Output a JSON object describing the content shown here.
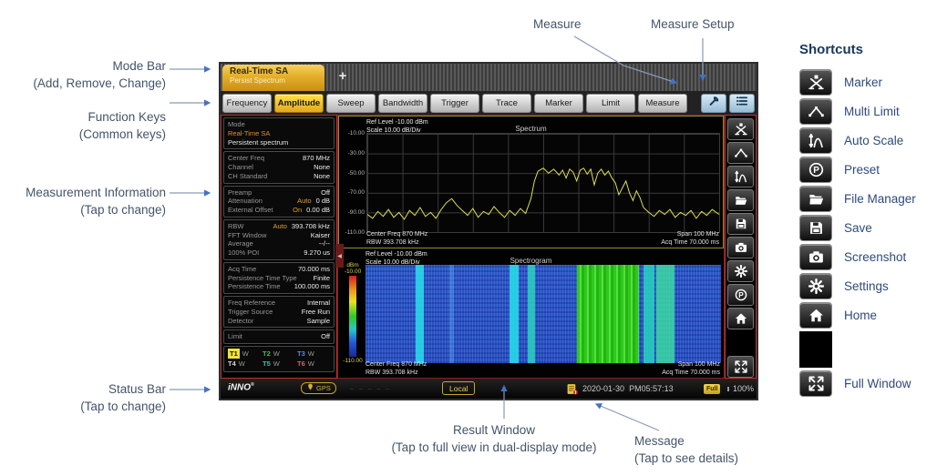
{
  "annotations": {
    "measure": "Measure",
    "measure_setup": "Measure Setup",
    "mode_bar": {
      "line1": "Mode Bar",
      "line2": "(Add, Remove, Change)"
    },
    "function_keys": {
      "line1": "Function Keys",
      "line2": "(Common keys)"
    },
    "measurement_info": {
      "line1": "Measurement Information",
      "line2": "(Tap to change)"
    },
    "status_bar": {
      "line1": "Status Bar",
      "line2": "(Tap to change)"
    },
    "result_window": {
      "line1": "Result Window",
      "line2": "(Tap to full view in dual-display mode)"
    },
    "message": {
      "line1": "Message",
      "line2": "(Tap to see details)"
    }
  },
  "shortcuts": {
    "title": "Shortcuts",
    "items": [
      {
        "icon": "marker",
        "label": "Marker"
      },
      {
        "icon": "multi-limit",
        "label": "Multi Limit"
      },
      {
        "icon": "auto-scale",
        "label": "Auto Scale"
      },
      {
        "icon": "preset",
        "label": "Preset"
      },
      {
        "icon": "file-manager",
        "label": "File Manager"
      },
      {
        "icon": "save",
        "label": "Save"
      },
      {
        "icon": "screenshot",
        "label": "Screenshot"
      },
      {
        "icon": "settings",
        "label": "Settings"
      },
      {
        "icon": "home",
        "label": "Home"
      },
      {
        "icon": "full-window",
        "label": "Full Window"
      }
    ]
  },
  "device": {
    "mode_tab": {
      "title": "Real-Time SA",
      "subtitle": "Persist Spectrum",
      "add_label": "+"
    },
    "function_keys": [
      "Frequency",
      "Amplitude",
      "Sweep",
      "Bandwidth",
      "Trigger",
      "Trace",
      "Marker",
      "Limit",
      "Measure"
    ],
    "active_function_key": "Amplitude",
    "side_strip": [
      "marker",
      "multi-limit",
      "auto-scale",
      "file-manager",
      "save",
      "screenshot",
      "settings",
      "preset",
      "home",
      "full-window"
    ],
    "info_panel": {
      "sections": [
        {
          "rows": [
            {
              "l": "Mode",
              "v": ""
            },
            {
              "l": "Real-Time SA",
              "v": "",
              "lc": "accent"
            },
            {
              "l": "Persistent spectrum",
              "v": "",
              "lc": "white"
            }
          ]
        },
        {
          "rows": [
            {
              "l": "Center Freq",
              "v": "870 MHz"
            },
            {
              "l": "Channel",
              "v": "None"
            },
            {
              "l": "CH Standard",
              "v": "None"
            }
          ]
        },
        {
          "rows": [
            {
              "l": "Preamp",
              "v": "Off"
            },
            {
              "l": "Attenuation",
              "m": "Auto",
              "v": "0 dB"
            },
            {
              "l": "External Offset",
              "m": "On",
              "v": "0.00 dB"
            }
          ]
        },
        {
          "rows": [
            {
              "l": "RBW",
              "m": "Auto",
              "v": "393.708 kHz"
            },
            {
              "l": "FFT Window",
              "v": "Kaiser"
            },
            {
              "l": "Average",
              "v": "--/--"
            },
            {
              "l": "100% POI",
              "v": "9.270 us"
            }
          ]
        },
        {
          "rows": [
            {
              "l": "Acq Time",
              "v": "70.000 ms"
            },
            {
              "l": "Persistence Time Type",
              "v": "Finite"
            },
            {
              "l": "Persistence Time",
              "v": "100.000 ms"
            }
          ]
        },
        {
          "rows": [
            {
              "l": "Freq Reference",
              "v": "Internal"
            },
            {
              "l": "Trigger Source",
              "v": "Free Run"
            },
            {
              "l": "Detector",
              "v": "Sample"
            }
          ]
        },
        {
          "rows": [
            {
              "l": "Limit",
              "v": "Off"
            }
          ]
        }
      ],
      "traces": [
        {
          "name": "T1",
          "type": "W",
          "color": "#f3e13a",
          "selected": true
        },
        {
          "name": "T2",
          "type": "W",
          "color": "#49b84f",
          "selected": false
        },
        {
          "name": "T3",
          "type": "W",
          "color": "#5a8ae0",
          "selected": false
        },
        {
          "name": "T4",
          "type": "W",
          "color": "#d8d8d8",
          "selected": false
        },
        {
          "name": "T5",
          "type": "W",
          "color": "#35c4a8",
          "selected": false
        },
        {
          "name": "T6",
          "type": "W",
          "color": "#e25b78",
          "selected": false
        }
      ]
    },
    "windows": {
      "spectrum": {
        "ref_level": "Ref Level -10.00 dBm",
        "scale": "Scale 10.00 dB/Div",
        "title": "Spectrum",
        "y_ticks": [
          "-10.00",
          "-30.00",
          "-50.00",
          "-70.00",
          "-90.00",
          "-110.00"
        ],
        "footer": {
          "left1": "Center Freq 870 MHz",
          "left2": "RBW 393.708 kHz",
          "right1": "Span 100 MHz",
          "right2": "Acq Time 70.000 ms"
        }
      },
      "spectrogram": {
        "ref_level": "Ref Level -10.00 dBm",
        "scale": "Scale 10.00 dB/Div",
        "title": "Spectrogram",
        "colorbar": {
          "unit": "dBm",
          "top": "-10.00",
          "bottom": "-110.00"
        },
        "footer": {
          "left1": "Center Freq 870 MHz",
          "left2": "RBW 393.708 kHz",
          "right1": "Span 100 MHz",
          "right2": "Acq Time 70.000 ms"
        }
      }
    },
    "status_bar": {
      "logo": "iNNO",
      "logo_reg": "®",
      "gps_label": "GPS",
      "gps_placeholder": "– – – – –",
      "local": "Local",
      "date": "2020-01-30",
      "time": "PM05:57:13",
      "battery": "Full",
      "battery_percent": "100%"
    }
  },
  "chart_data": [
    {
      "type": "line",
      "title": "Spectrum",
      "series_color": "#dede4e",
      "ref_level_dbm": -10,
      "scale_db_per_div": 10,
      "ylim": [
        -110,
        -10
      ],
      "center_freq_mhz": 870,
      "span_mhz": 100,
      "rbw_khz": 393.708,
      "acq_time_ms": 70,
      "x_unit": "% of span",
      "y_unit": "dBm",
      "points": [
        [
          0,
          -92
        ],
        [
          1.5,
          -96
        ],
        [
          3,
          -89
        ],
        [
          4.5,
          -94
        ],
        [
          6,
          -87
        ],
        [
          7.5,
          -95
        ],
        [
          9,
          -90
        ],
        [
          10.5,
          -97
        ],
        [
          12,
          -88
        ],
        [
          13.5,
          -93
        ],
        [
          15,
          -85
        ],
        [
          16.5,
          -94
        ],
        [
          18,
          -90
        ],
        [
          19.5,
          -96
        ],
        [
          21,
          -87
        ],
        [
          22.5,
          -80
        ],
        [
          24,
          -76
        ],
        [
          25.5,
          -83
        ],
        [
          27,
          -88
        ],
        [
          28.5,
          -93
        ],
        [
          30,
          -86
        ],
        [
          31.5,
          -95
        ],
        [
          33,
          -89
        ],
        [
          34.5,
          -92
        ],
        [
          36,
          -84
        ],
        [
          37.5,
          -90
        ],
        [
          39,
          -95
        ],
        [
          40.5,
          -88
        ],
        [
          42,
          -93
        ],
        [
          43.5,
          -86
        ],
        [
          45,
          -91
        ],
        [
          46.5,
          -76
        ],
        [
          47.5,
          -58
        ],
        [
          48.5,
          -48
        ],
        [
          50,
          -45
        ],
        [
          51.5,
          -50
        ],
        [
          53,
          -46
        ],
        [
          54.5,
          -52
        ],
        [
          55.5,
          -47
        ],
        [
          56.5,
          -55
        ],
        [
          57.5,
          -46
        ],
        [
          58.5,
          -49
        ],
        [
          59.5,
          -58
        ],
        [
          60.5,
          -47
        ],
        [
          61.5,
          -45
        ],
        [
          62.5,
          -51
        ],
        [
          63.5,
          -46
        ],
        [
          64.5,
          -62
        ],
        [
          65.5,
          -50
        ],
        [
          66.5,
          -46
        ],
        [
          67.5,
          -52
        ],
        [
          68.5,
          -48
        ],
        [
          69.5,
          -55
        ],
        [
          70.5,
          -60
        ],
        [
          71.5,
          -72
        ],
        [
          72.5,
          -65
        ],
        [
          73.5,
          -58
        ],
        [
          74.5,
          -70
        ],
        [
          75.5,
          -78
        ],
        [
          76.5,
          -68
        ],
        [
          77.5,
          -75
        ],
        [
          78.5,
          -85
        ],
        [
          80,
          -90
        ],
        [
          81.5,
          -94
        ],
        [
          83,
          -88
        ],
        [
          84.5,
          -92
        ],
        [
          86,
          -87
        ],
        [
          87.5,
          -95
        ],
        [
          89,
          -90
        ],
        [
          90.5,
          -93
        ],
        [
          92,
          -88
        ],
        [
          93.5,
          -96
        ],
        [
          95,
          -89
        ],
        [
          96.5,
          -93
        ],
        [
          98,
          -87
        ],
        [
          100,
          -92
        ]
      ]
    },
    {
      "type": "heatmap",
      "title": "Spectrogram",
      "x_unit": "% of span",
      "colorbar_dbm": [
        -10,
        -110
      ],
      "bands": [
        {
          "x": 14.2,
          "w": 2.2,
          "c": "cyan"
        },
        {
          "x": 23.5,
          "w": 1.4,
          "c": "faint"
        },
        {
          "x": 40.6,
          "w": 2.6,
          "c": "cyan"
        },
        {
          "x": 45.6,
          "w": 2.0,
          "c": "teal"
        },
        {
          "x": 59.5,
          "w": 17.5,
          "c": "green"
        },
        {
          "x": 78.2,
          "w": 3.2,
          "c": "teal"
        },
        {
          "x": 81.8,
          "w": 5.2,
          "c": "cyan2"
        }
      ]
    }
  ]
}
